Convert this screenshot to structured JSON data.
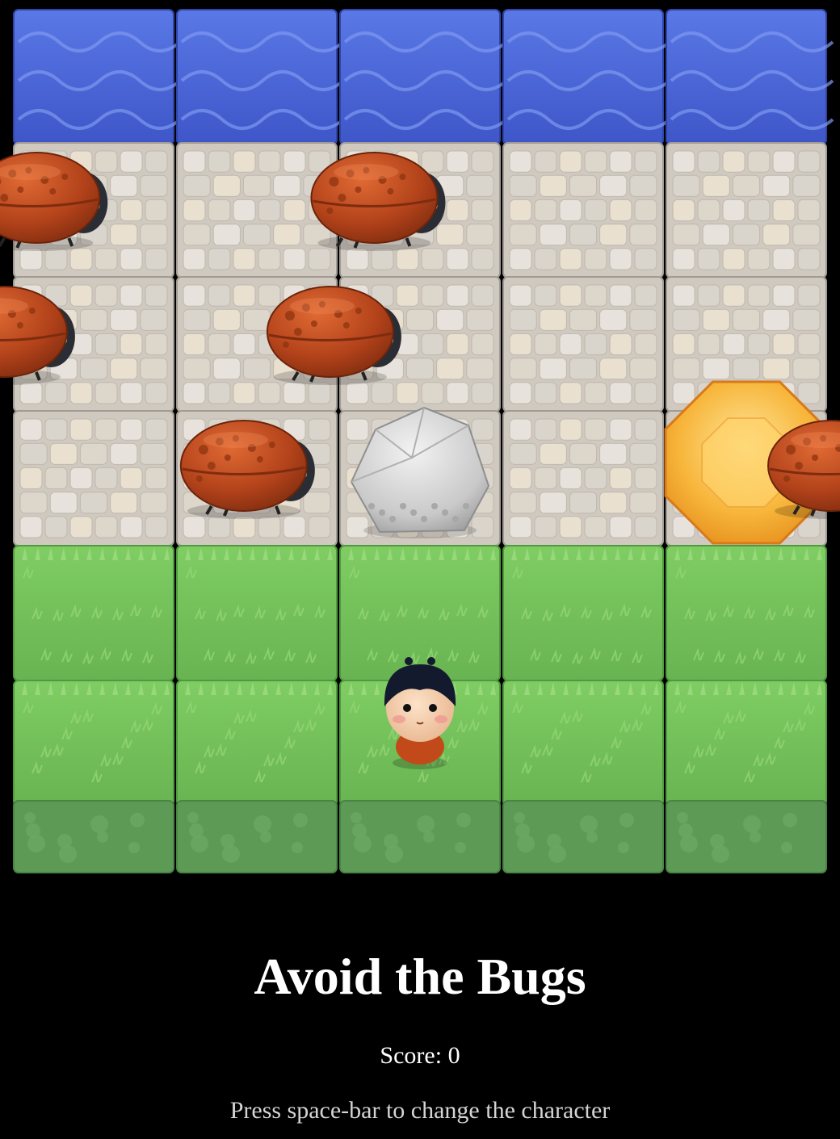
{
  "game": {
    "title": "Avoid the Bugs",
    "score_label": "Score:",
    "score_value": "0",
    "score_text": "Score: 0",
    "hint": "Press space-bar to change the character"
  },
  "board": {
    "columns": 5,
    "rows": [
      {
        "tile": "water",
        "name": "water-row"
      },
      {
        "tile": "stone",
        "name": "stone-row-1"
      },
      {
        "tile": "stone",
        "name": "stone-row-2"
      },
      {
        "tile": "stone",
        "name": "stone-row-3"
      },
      {
        "tile": "grass",
        "name": "grass-row-1"
      },
      {
        "tile": "grass",
        "name": "grass-row-2"
      }
    ],
    "entities": [
      {
        "kind": "bug",
        "name": "enemy-bug-icon",
        "row": 1,
        "col": -0.35
      },
      {
        "kind": "bug",
        "name": "enemy-bug-icon",
        "row": 1,
        "col": 1.72
      },
      {
        "kind": "bug",
        "name": "enemy-bug-icon",
        "row": 2,
        "col": -0.55
      },
      {
        "kind": "bug",
        "name": "enemy-bug-icon",
        "row": 2,
        "col": 1.45
      },
      {
        "kind": "bug",
        "name": "enemy-bug-icon",
        "row": 3,
        "col": 0.92
      },
      {
        "kind": "rock",
        "name": "rock-icon",
        "row": 3,
        "col": 2
      },
      {
        "kind": "gem",
        "name": "orange-gem-icon",
        "row": 3,
        "col": 4
      },
      {
        "kind": "bug",
        "name": "enemy-bug-icon",
        "row": 3,
        "col": 4.52
      },
      {
        "kind": "player",
        "name": "player-boy-icon",
        "row": 5,
        "col": 2
      }
    ]
  },
  "colors": {
    "background": "#000000",
    "water": "#4a66d8",
    "stone": "#dcd6cc",
    "grass": "#74c25a",
    "dirt": "#5c9a56",
    "bug_shell": "#b84a1e",
    "gem": "#f3a82b",
    "rock": "#c8c8c8"
  }
}
